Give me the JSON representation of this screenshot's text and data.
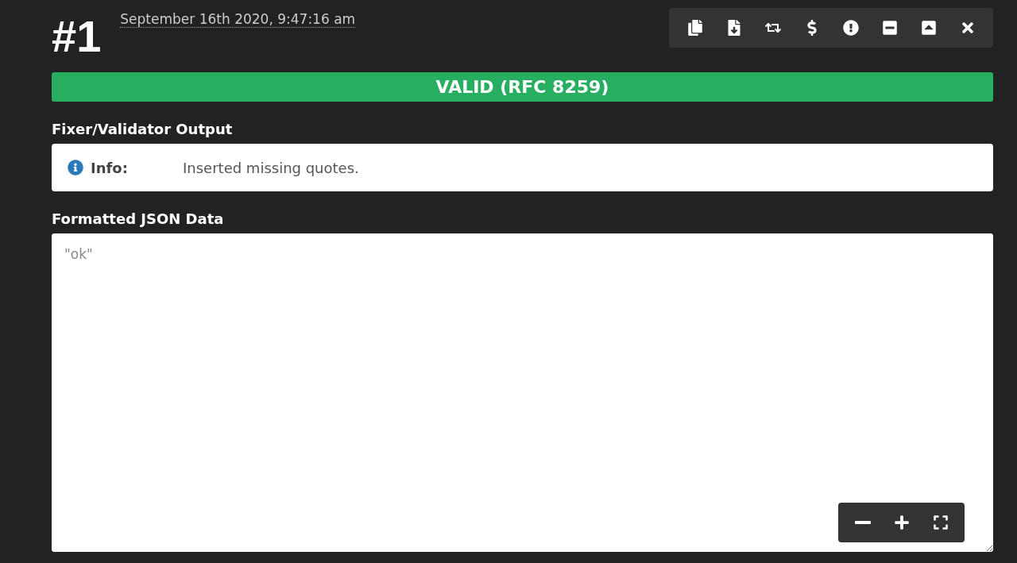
{
  "header": {
    "number": "#1",
    "timestamp": "September 16th 2020, 9:47:16 am"
  },
  "status": {
    "text": "VALID (RFC 8259)",
    "valid": true
  },
  "output": {
    "heading": "Fixer/Validator Output",
    "messages": [
      {
        "kind": "info",
        "label": "Info:",
        "text": "Inserted missing quotes."
      }
    ]
  },
  "editor": {
    "heading": "Formatted JSON Data",
    "value": "\"ok\""
  }
}
